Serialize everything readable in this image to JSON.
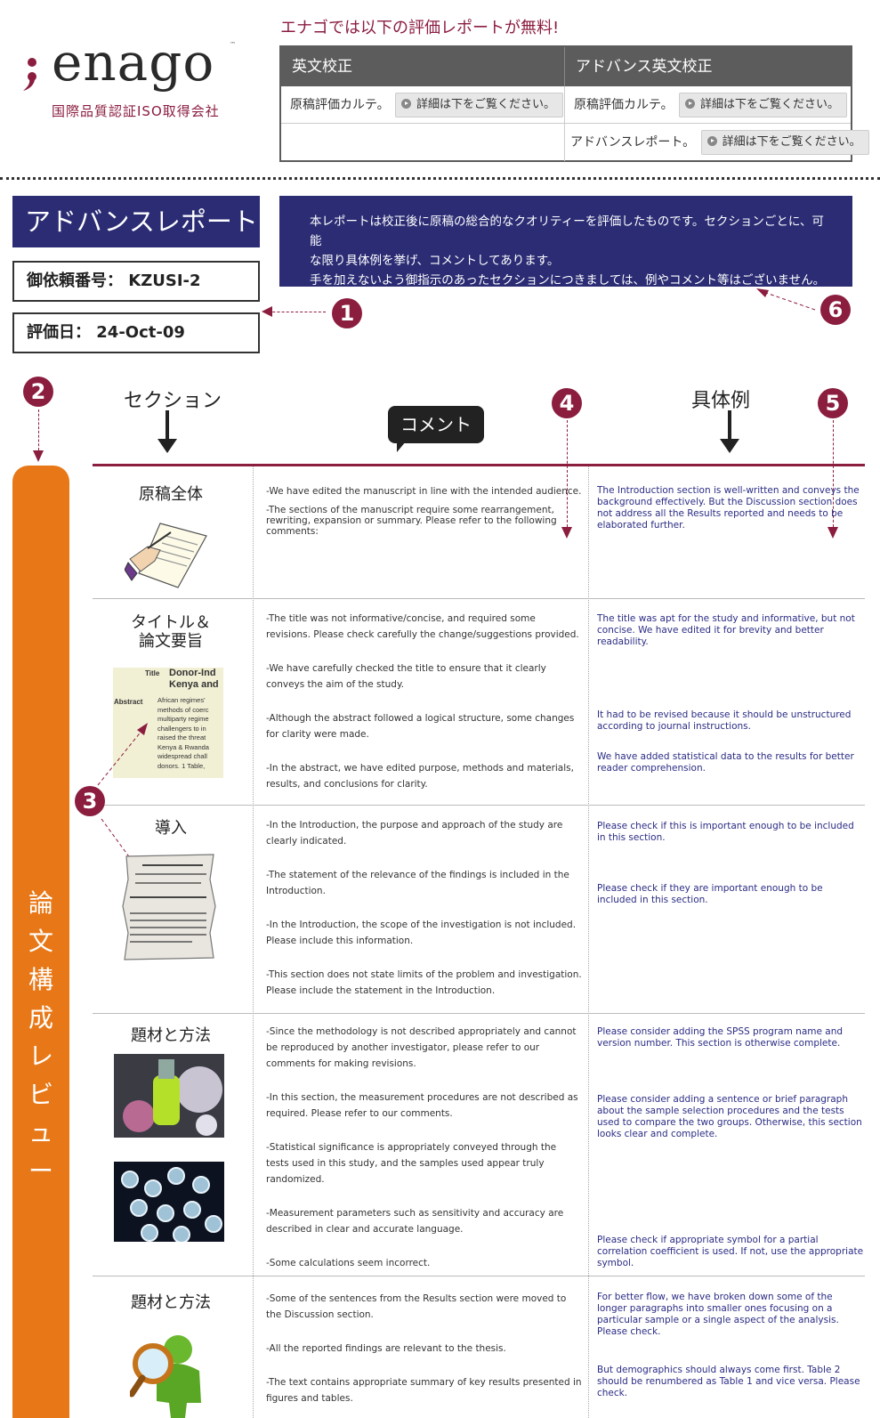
{
  "logo": {
    "name": "enago",
    "tm": "™",
    "tagline": "国際品質認証ISO取得会社"
  },
  "free_reports": {
    "title": "エナゴでは以下の評価レポートが無料!",
    "columns": [
      "英文校正",
      "アドバンス英文校正"
    ],
    "rows": [
      [
        "原稿評価カルテ。",
        "原稿評価カルテ。"
      ],
      [
        "",
        "アドバンスレポート。"
      ]
    ],
    "button_label": "詳細は下をご覧ください。"
  },
  "report": {
    "title": "アドバンスレポート",
    "request_no": "御依頼番号： KZUSI-2",
    "eval_date": "評価日： 24-Oct-09",
    "notice": [
      "本レポートは校正後に原稿の総合的なクオリティーを評価したものです。セクションごとに、可能",
      "な限り具体例を挙げ、コメントしてあります。",
      "手を加えないよう御指示のあったセクションにつきましては、例やコメント等はございません。"
    ]
  },
  "markers": {
    "m1": "1",
    "m2": "2",
    "m3": "3",
    "m4": "4",
    "m5": "5",
    "m6": "6"
  },
  "columns": {
    "section": "セクション",
    "comment": "コメント",
    "examples": "具体例"
  },
  "side_label": [
    "論",
    "文",
    "構",
    "成",
    "レ",
    "ビ",
    "ュ",
    "ー"
  ],
  "icons": [
    "hand-writing-icon",
    "abstract-thumbnail",
    "document-icon",
    "lab-photo",
    "magnifier-person-icon"
  ],
  "sections": [
    {
      "name": "原稿全体",
      "comments": [
        "-We have edited the manuscript in line with the intended audience.",
        "-The sections of the manuscript require some rearrangement, rewriting, expansion or summary. Please refer to the following comments:"
      ],
      "examples": [
        "The Introduction section is well-written and conveys the background effectively. But the Discussion section does not address all the Results reported and needs to be elaborated further."
      ]
    },
    {
      "name": "タイトル＆\n論文要旨",
      "thumb": {
        "title_label": "Title",
        "title_text": "Donor-Ind Kenya and",
        "abstract_label": "Abstract",
        "abstract_text": "African regimes' methods of coerc multiparty regime challengers to in raised the threat Kenya & Rwanda widespread chall donors. 1 Table,"
      },
      "comments": [
        "-The title was not informative/concise, and required some revisions. Please check carefully the change/suggestions provided.",
        "-We have carefully checked the title to ensure that it clearly conveys the aim of the study.",
        "-Although the abstract followed a logical structure, some changes for clarity were made.",
        "-In the abstract, we have edited purpose, methods and materials, results, and conclusions for clarity."
      ],
      "examples": [
        "The title was apt for the study and informative, but not concise. We have edited it for brevity and better readability.",
        "It had to be revised because it should be unstructured according to journal instructions.",
        "We have added statistical data to the results for better reader comprehension."
      ]
    },
    {
      "name": "導入",
      "comments": [
        "-In the Introduction, the purpose and approach of the study are clearly indicated.",
        "-The statement of the relevance of the findings is included in the Introduction.",
        "-In the Introduction, the scope of the investigation is not included. Please include this information.",
        "-This section does not state limits of the problem and investigation. Please include the statement in the Introduction."
      ],
      "examples": [
        "Please check if this is important enough to be included in this section.",
        "Please check if they are important enough to be included in this section."
      ]
    },
    {
      "name": "題材と方法",
      "comments": [
        "-Since the methodology is not described appropriately and cannot be reproduced by another investigator, please refer to our comments for making revisions.",
        "-In this section, the measurement procedures are not described as required. Please refer to our comments.",
        "-Statistical significance is appropriately conveyed through the tests used in this study, and the samples used appear truly randomized.",
        "-Measurement parameters such as sensitivity and accuracy are described in clear and accurate language.",
        "-Some calculations seem incorrect."
      ],
      "examples": [
        "Please consider adding the SPSS program name and version number. This section is otherwise complete.",
        "Please consider adding a sentence or brief paragraph about the sample selection procedures and the tests used to compare the two groups. Otherwise, this section looks clear and complete.",
        "Please check if appropriate symbol for a partial correlation coefficient is used. If not, use the appropriate symbol."
      ]
    },
    {
      "name": "題材と方法",
      "comments": [
        "-Some of the sentences from the Results section were moved to the Discussion section.",
        "-All the reported findings are relevant to the thesis.",
        "-The text contains appropriate summary of key results presented in figures and tables."
      ],
      "examples": [
        "For better flow, we have broken down some of the longer paragraphs into smaller ones focusing on a particular sample or a single aspect of the analysis. Please check.",
        "But demographics should always come first. Table 2 should be renumbered as Table 1 and vice versa. Please check."
      ]
    }
  ]
}
